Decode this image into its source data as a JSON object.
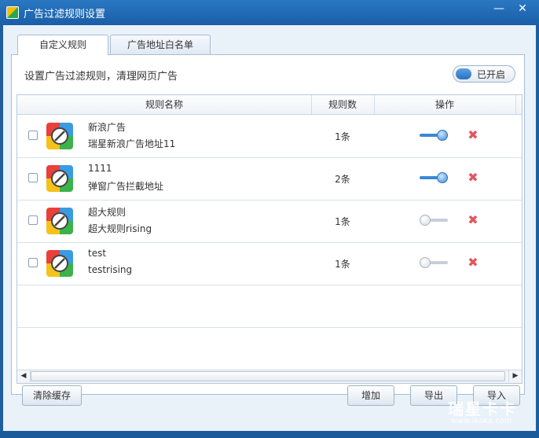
{
  "window": {
    "title": "广告过滤规则设置",
    "minimize": "—",
    "close": "✕"
  },
  "tabs": [
    {
      "label": "自定义规则"
    },
    {
      "label": "广告地址白名单"
    }
  ],
  "description": "设置广告过滤规则，清理网页广告",
  "master_toggle": {
    "label": "已开启",
    "on": true
  },
  "table": {
    "headers": {
      "name": "规则名称",
      "count": "规则数",
      "ops": "操作"
    },
    "rows": [
      {
        "name": "新浪广告",
        "desc": "瑞星新浪广告地址11",
        "count": "1条",
        "enabled": true
      },
      {
        "name": "1111",
        "desc": "弹窗广告拦截地址",
        "count": "2条",
        "enabled": true
      },
      {
        "name": "超大规则",
        "desc": "超大规则rising",
        "count": "1条",
        "enabled": false
      },
      {
        "name": "test",
        "desc": "testrising",
        "count": "1条",
        "enabled": false
      }
    ]
  },
  "buttons": {
    "clear_cache": "清除缓存",
    "add": "增加",
    "export": "导出",
    "import": "导入"
  },
  "watermark": {
    "brand": "瑞星卡卡",
    "url": "www.ikaka.com"
  },
  "colors": {
    "accent": "#2a78c2",
    "delete": "#e0575e",
    "toggle_on": "#3a88d6"
  }
}
